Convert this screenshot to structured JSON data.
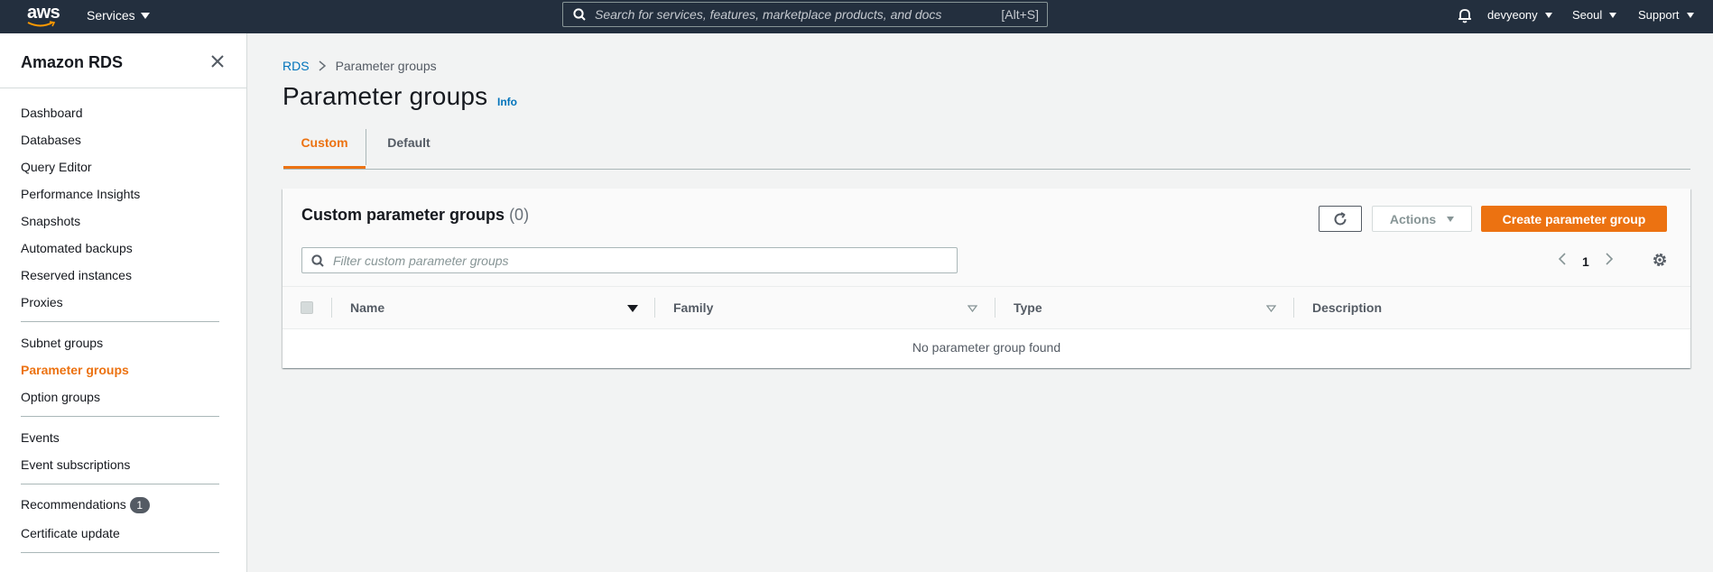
{
  "topnav": {
    "logo_text": "aws",
    "services_label": "Services",
    "search_placeholder": "Search for services, features, marketplace products, and docs",
    "search_shortcut": "[Alt+S]",
    "user": "devyeony",
    "region": "Seoul",
    "support": "Support"
  },
  "sidenav": {
    "title": "Amazon RDS",
    "groups": [
      [
        "Dashboard",
        "Databases",
        "Query Editor",
        "Performance Insights",
        "Snapshots",
        "Automated backups",
        "Reserved instances",
        "Proxies"
      ],
      [
        "Subnet groups",
        "Parameter groups",
        "Option groups"
      ],
      [
        "Events",
        "Event subscriptions"
      ],
      [
        "Recommendations",
        "Certificate update"
      ]
    ],
    "active": "Parameter groups",
    "recommendations_badge": "1"
  },
  "breadcrumb": {
    "root": "RDS",
    "current": "Parameter groups"
  },
  "page": {
    "title": "Parameter groups",
    "info": "Info"
  },
  "tabs": {
    "custom": "Custom",
    "default": "Default"
  },
  "panel": {
    "title": "Custom parameter groups",
    "count": "(0)",
    "actions_label": "Actions",
    "create_label": "Create parameter group",
    "filter_placeholder": "Filter custom parameter groups",
    "page_number": "1",
    "columns": [
      "Name",
      "Family",
      "Type",
      "Description"
    ],
    "empty_message": "No parameter group found"
  }
}
